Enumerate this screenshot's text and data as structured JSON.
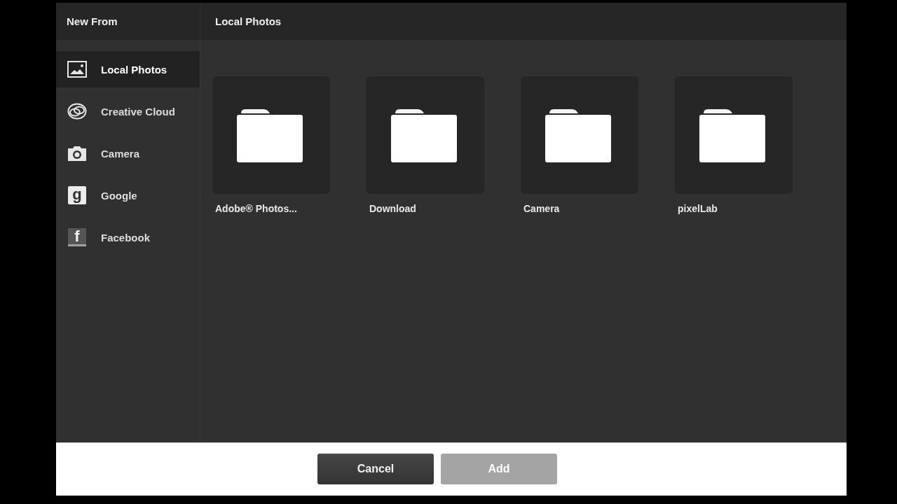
{
  "header": {
    "sidebar_title": "New From",
    "title": "Local Photos"
  },
  "sources": [
    {
      "label": "Local Photos",
      "kind": "photos",
      "selected": true
    },
    {
      "label": "Creative Cloud",
      "kind": "rings",
      "selected": false
    },
    {
      "label": "Camera",
      "kind": "camera",
      "selected": false
    },
    {
      "label": "Google",
      "kind": "light-tile",
      "glyph": "g",
      "selected": false
    },
    {
      "label": "Facebook",
      "kind": "dark-tile",
      "glyph": "f",
      "selected": false
    }
  ],
  "folders": [
    {
      "name": "Adobe® Photos..."
    },
    {
      "name": "Download"
    },
    {
      "name": "Camera"
    },
    {
      "name": "pixelLab"
    }
  ],
  "buttons": [
    {
      "label": "Cancel",
      "disabled": false
    },
    {
      "label": "Add",
      "disabled": true
    }
  ]
}
